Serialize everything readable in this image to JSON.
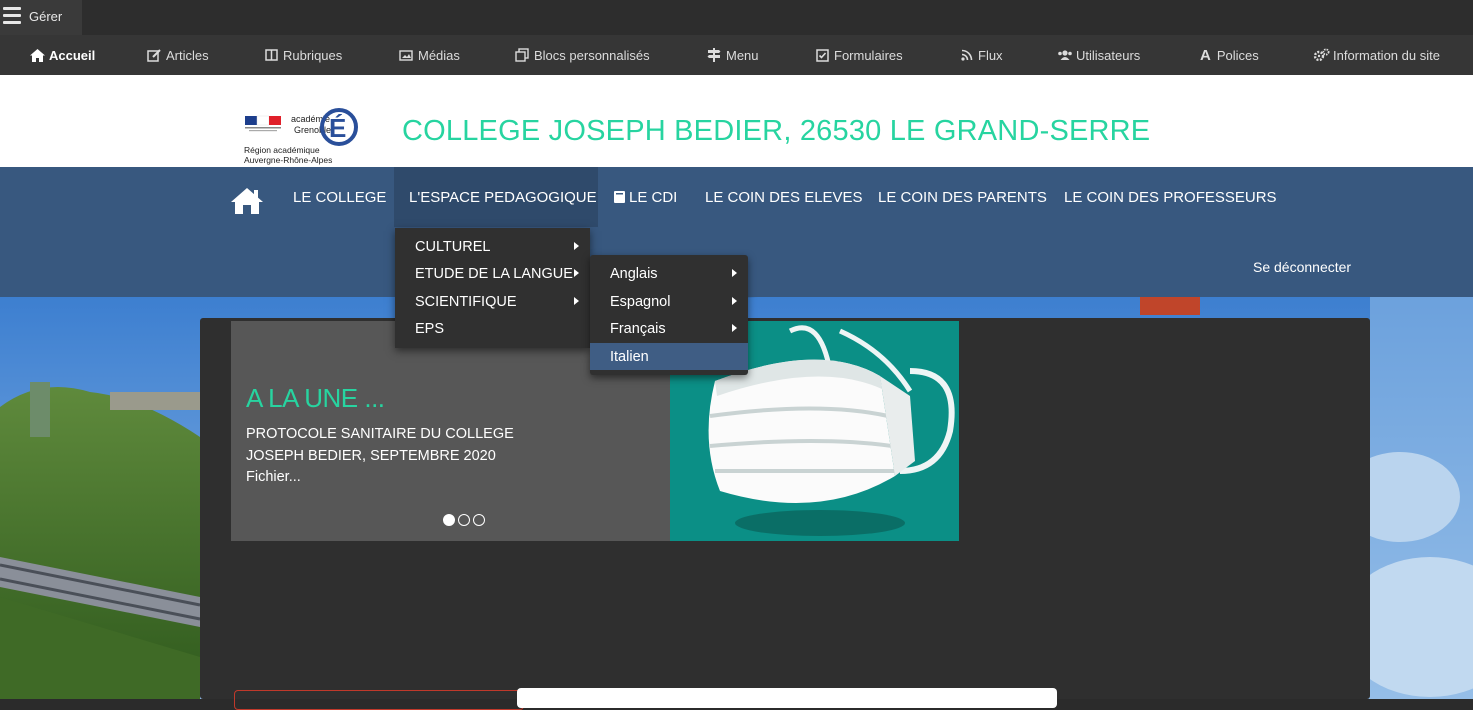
{
  "admin": {
    "manage_label": "Gérer",
    "items": [
      {
        "label": "Accueil",
        "icon": "home-icon"
      },
      {
        "label": "Articles",
        "icon": "edit-icon"
      },
      {
        "label": "Rubriques",
        "icon": "book-icon"
      },
      {
        "label": "Médias",
        "icon": "image-icon"
      },
      {
        "label": "Blocs personnalisés",
        "icon": "copy-icon"
      },
      {
        "label": "Menu",
        "icon": "signpost-icon"
      },
      {
        "label": "Formulaires",
        "icon": "checkbox-icon"
      },
      {
        "label": "Flux",
        "icon": "rss-icon"
      },
      {
        "label": "Utilisateurs",
        "icon": "users-icon"
      },
      {
        "label": "Polices",
        "icon": "font-icon"
      },
      {
        "label": "Information du site",
        "icon": "cogs-icon"
      }
    ]
  },
  "header": {
    "logo_lines": [
      "académie",
      "Grenoble",
      "Région académique",
      "Auvergne-Rhône-Alpes"
    ],
    "site_title": "COLLEGE JOSEPH BEDIER, 26530 LE GRAND-SERRE"
  },
  "nav": {
    "items": [
      {
        "label": "LE COLLEGE"
      },
      {
        "label": "L'ESPACE PEDAGOGIQUE"
      },
      {
        "label": "LE CDI"
      },
      {
        "label": "LE COIN DES ELEVES"
      },
      {
        "label": "LE COIN DES PARENTS"
      },
      {
        "label": "LE COIN DES PROFESSEURS"
      }
    ],
    "logout_label": "Se déconnecter"
  },
  "dropdown": {
    "items": [
      {
        "label": "CULTUREL"
      },
      {
        "label": "ETUDE DE LA LANGUE"
      },
      {
        "label": "SCIENTIFIQUE"
      },
      {
        "label": "EPS"
      }
    ],
    "submenu": [
      {
        "label": "Anglais"
      },
      {
        "label": "Espagnol"
      },
      {
        "label": "Français"
      },
      {
        "label": "Italien"
      }
    ]
  },
  "slider": {
    "heading": "A LA UNE ...",
    "text_lines": [
      "PROTOCOLE SANITAIRE DU COLLEGE",
      "JOSEPH BEDIER, SEPTEMBRE 2020",
      "Fichier..."
    ],
    "active_slide": 1,
    "slide_count": 3
  },
  "colors": {
    "accent": "#27d4a0",
    "nav_bg": "#38587f",
    "admin_bg": "#363636"
  }
}
